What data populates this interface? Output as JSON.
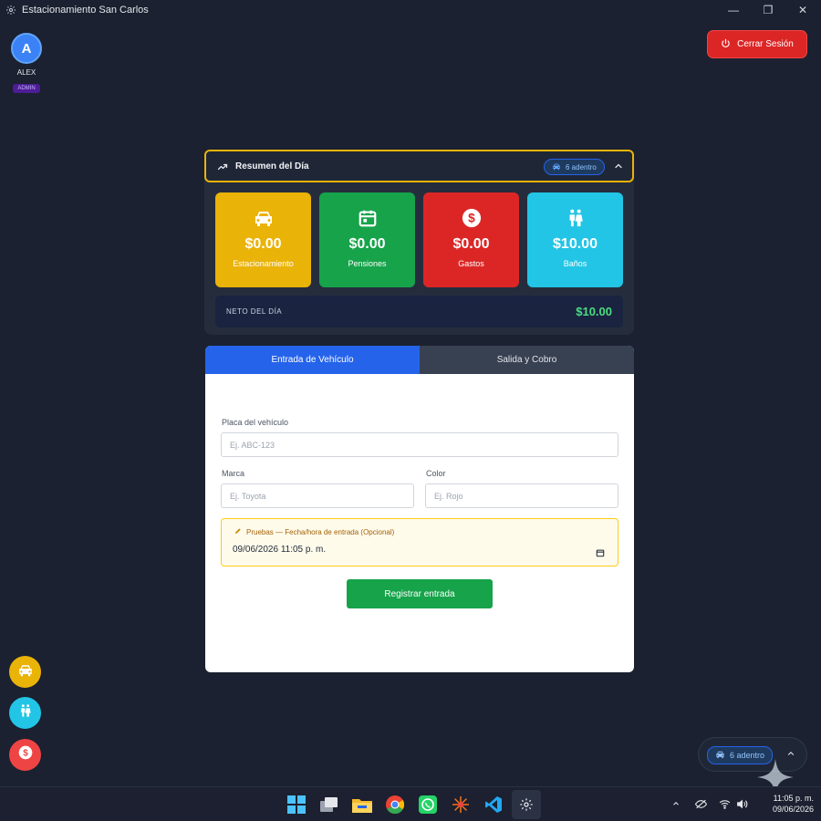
{
  "window": {
    "title": "Estacionamiento San Carlos",
    "minimize": "—",
    "restore": "❐",
    "close": "✕"
  },
  "user": {
    "initial": "A",
    "name": "ALEX",
    "role": "ADMIN"
  },
  "header": {
    "logout_label": "Cerrar Sesión"
  },
  "summary": {
    "title": "Resumen del Día",
    "inside_badge": "6 adentro",
    "cards": [
      {
        "amount": "$0.00",
        "label": "Estacionamiento",
        "color": "#eab308",
        "icon": "car-icon"
      },
      {
        "amount": "$0.00",
        "label": "Pensiones",
        "color": "#16a34a",
        "icon": "calendar-icon"
      },
      {
        "amount": "$0.00",
        "label": "Gastos",
        "color": "#dc2626",
        "icon": "dollar-icon"
      },
      {
        "amount": "$10.00",
        "label": "Baños",
        "color": "#22c5e6",
        "icon": "restroom-icon"
      }
    ],
    "net_label": "NETO DEL DÍA",
    "net_value": "$10.00"
  },
  "tabs": [
    {
      "label": "Entrada de Vehículo",
      "active": true
    },
    {
      "label": "Salida y Cobro",
      "active": false
    }
  ],
  "form": {
    "plate_label": "Placa del vehículo",
    "plate_placeholder": "Ej. ABC-123",
    "brand_label": "Marca",
    "brand_placeholder": "Ej. Toyota",
    "color_label": "Color",
    "color_placeholder": "Ej. Rojo",
    "test_label": "Pruebas — Fecha/hora de entrada (Opcional)",
    "test_value": "09/06/2026 11:05 p. m.",
    "submit_label": "Registrar entrada"
  },
  "quick_actions": [
    {
      "icon": "car-icon",
      "color": "#eab308"
    },
    {
      "icon": "restroom-icon",
      "color": "#22c5e6"
    },
    {
      "icon": "dollar-icon",
      "color": "#ef4444"
    }
  ],
  "widget": {
    "inside_badge": "6 adentro"
  },
  "taskbar": {
    "time": "11:05 p. m.",
    "date": "09/06/2026"
  }
}
